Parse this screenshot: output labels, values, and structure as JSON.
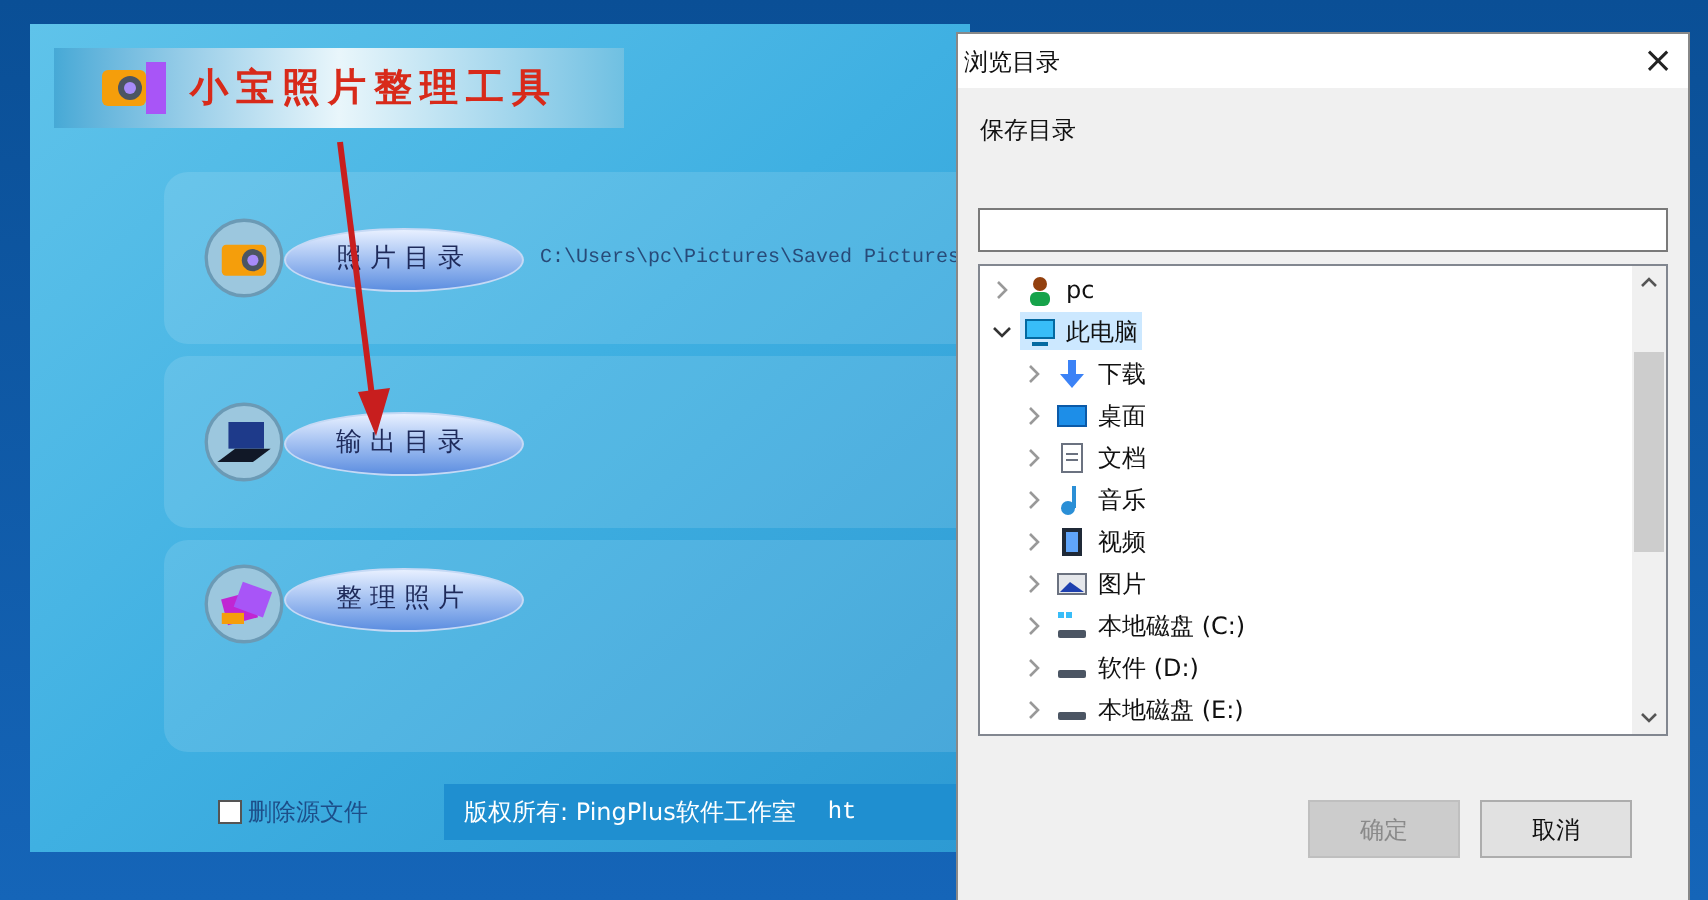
{
  "app_window": {
    "logo_title": "小宝照片整理工具",
    "actions": [
      {
        "kind": "camera",
        "label": "照片目录",
        "path": "C:\\Users\\pc\\Pictures\\Saved Pictures"
      },
      {
        "kind": "laptop",
        "label": "输出目录"
      },
      {
        "kind": "photos",
        "label": "整理照片"
      }
    ],
    "delete_source": {
      "label": "删除源文件",
      "checked": false
    },
    "copyright": "版权所有: PingPlus软件工作室",
    "link": "ht"
  },
  "dialog": {
    "title": "浏览目录",
    "close": "×",
    "label": "保存目录",
    "tree": [
      {
        "kind": "user",
        "label": "pc",
        "expanded": false,
        "selected": false
      },
      {
        "kind": "computer",
        "label": "此电脑",
        "expanded": true,
        "selected": true,
        "children": [
          {
            "kind": "download",
            "label": "下载",
            "expanded": false,
            "selected": false
          },
          {
            "kind": "desktop",
            "label": "桌面",
            "expanded": false,
            "selected": false
          },
          {
            "kind": "document",
            "label": "文档",
            "expanded": false,
            "selected": false
          },
          {
            "kind": "music",
            "label": "音乐",
            "expanded": false,
            "selected": false
          },
          {
            "kind": "video",
            "label": "视频",
            "expanded": false,
            "selected": false
          },
          {
            "kind": "picture",
            "label": "图片",
            "expanded": false,
            "selected": false
          },
          {
            "kind": "system-drive",
            "label": "本地磁盘 (C:)",
            "expanded": false,
            "selected": false
          },
          {
            "kind": "drive",
            "label": "软件 (D:)",
            "expanded": false,
            "selected": false
          },
          {
            "kind": "drive",
            "label": "本地磁盘 (E:)",
            "expanded": false,
            "selected": false
          }
        ]
      }
    ],
    "buttons": [
      {
        "label": "确定",
        "disabled": true
      },
      {
        "label": "取消",
        "disabled": false
      }
    ]
  }
}
